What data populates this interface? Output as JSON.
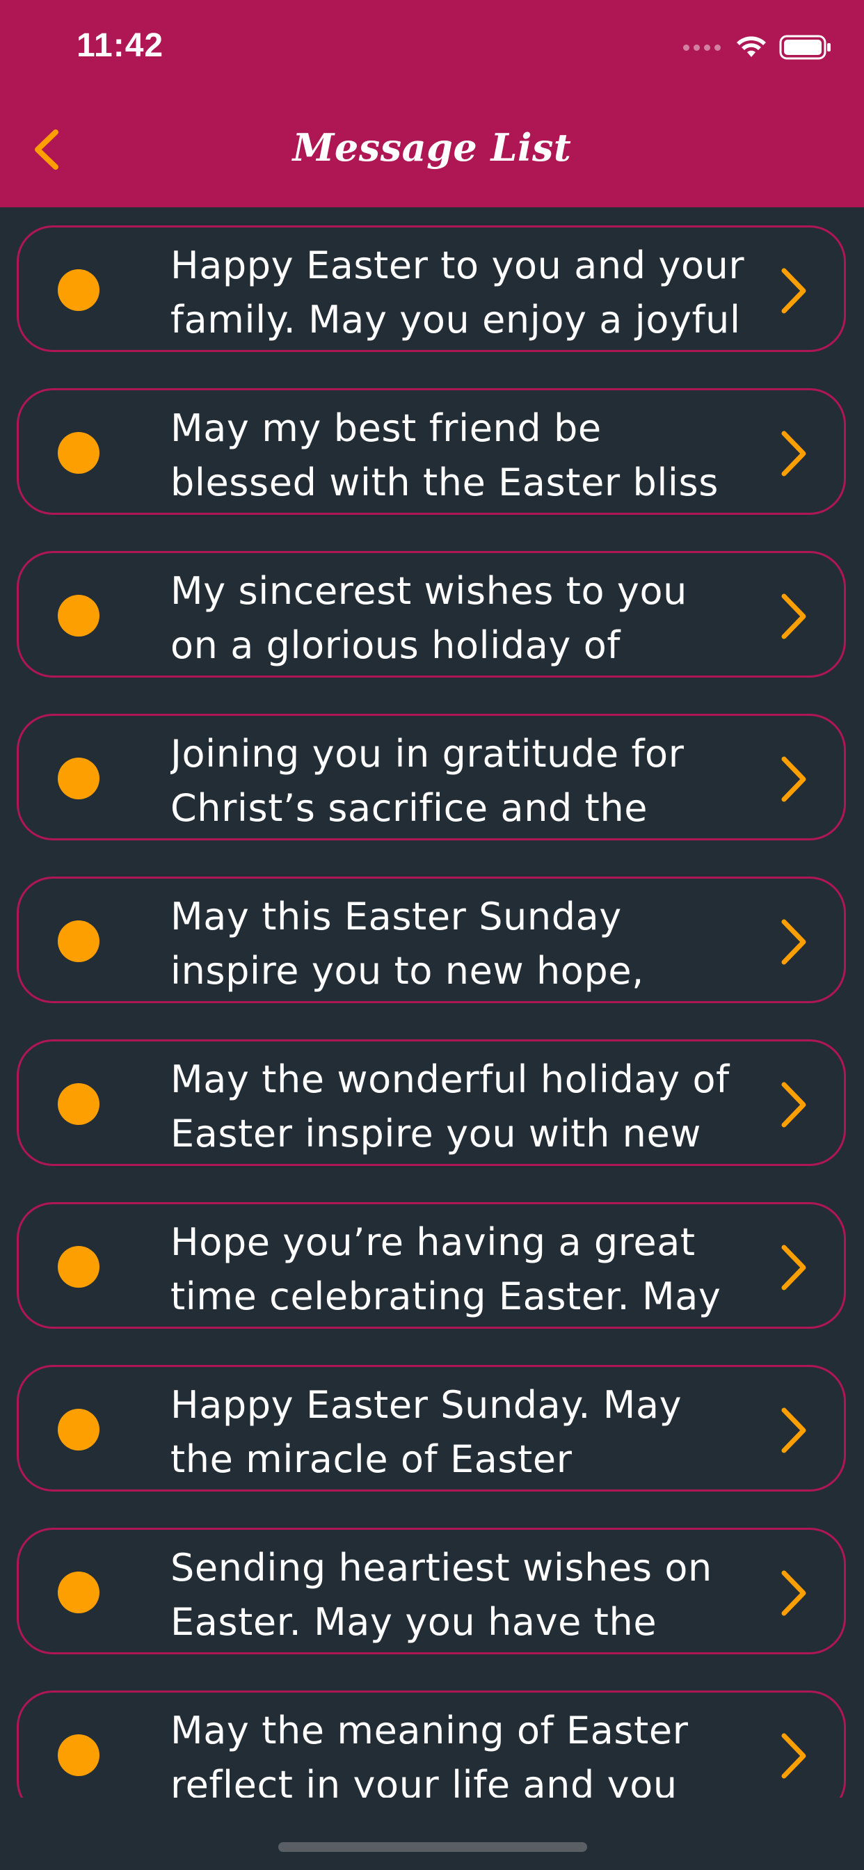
{
  "status_bar": {
    "time": "11:42"
  },
  "header": {
    "title": "Message List",
    "background_color": "#ae1654",
    "back_icon": "chevron-left-icon"
  },
  "colors": {
    "accent": "#fe9f00",
    "background": "#232d36",
    "border": "#ae1654",
    "text": "#ffffff"
  },
  "messages": [
    {
      "line1": "Happy Easter to you and your",
      "line2": "family. May you enjoy a joyful"
    },
    {
      "line1": "May my best friend be",
      "line2": "blessed with the Easter bliss"
    },
    {
      "line1": "My sincerest wishes to you",
      "line2": "on a glorious holiday of"
    },
    {
      "line1": "Joining you in gratitude for",
      "line2": "Christ’s sacrifice and the"
    },
    {
      "line1": "May this Easter Sunday",
      "line2": "inspire you to new hope,"
    },
    {
      "line1": "May the wonderful holiday of",
      "line2": "Easter inspire you with new"
    },
    {
      "line1": "Hope you’re having a great",
      "line2": "time celebrating Easter. May"
    },
    {
      "line1": "Happy Easter Sunday. May",
      "line2": "the miracle of Easter"
    },
    {
      "line1": "Sending heartiest wishes on",
      "line2": "Easter. May you have the"
    },
    {
      "line1": "May the meaning of Easter",
      "line2": "reflect in your life and you"
    }
  ]
}
